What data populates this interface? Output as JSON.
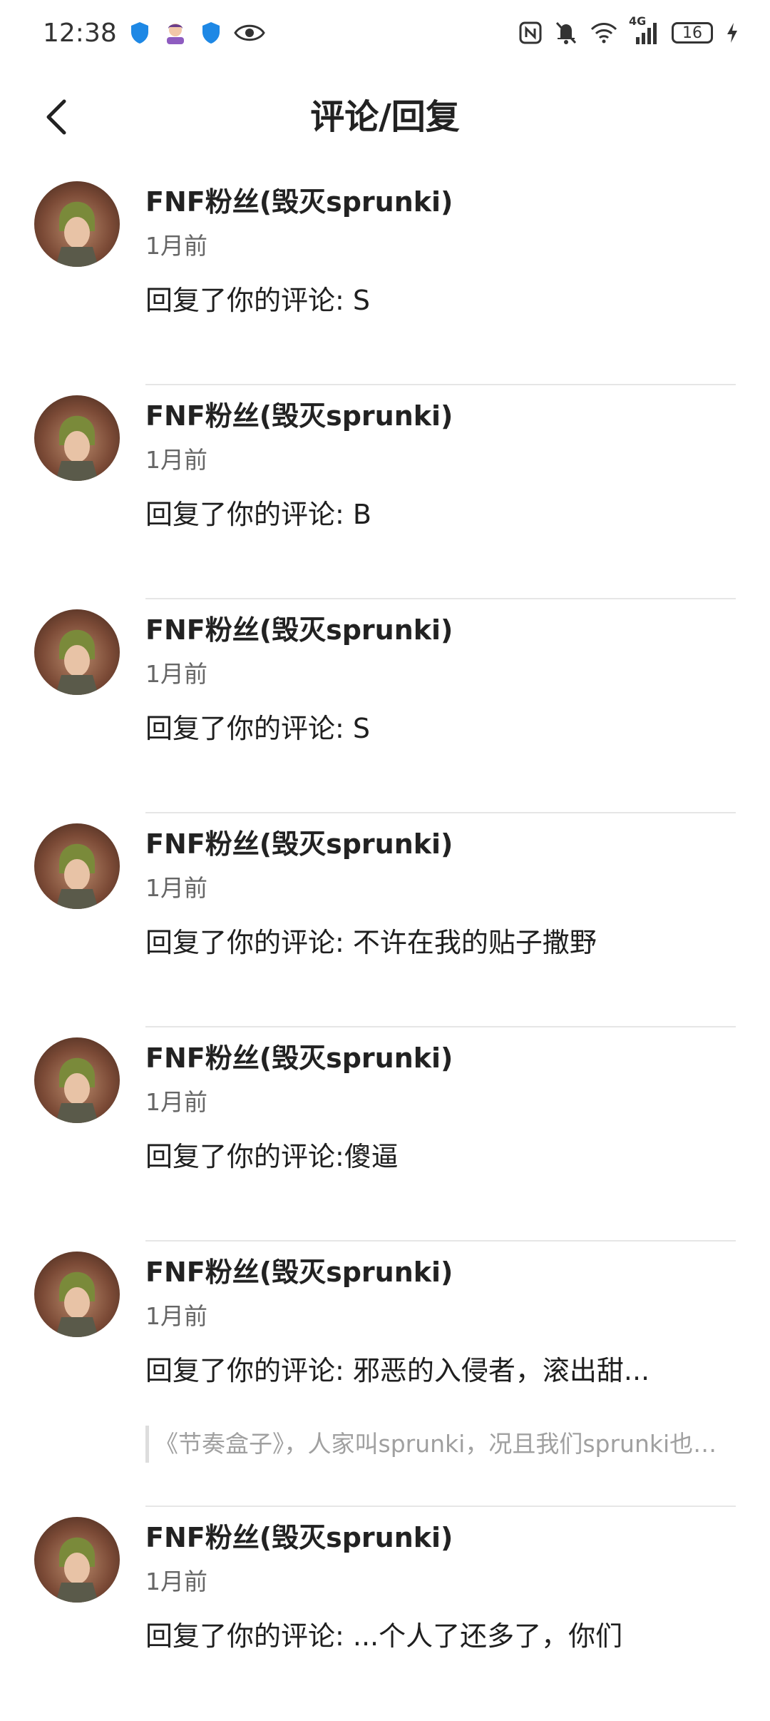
{
  "status_bar": {
    "time": "12:38",
    "network": "4G",
    "battery": "16"
  },
  "header": {
    "title": "评论/回复"
  },
  "notifications": [
    {
      "username": "FNF粉丝(毁灭sprunki)",
      "time": "1月前",
      "reply": "回复了你的评论: S"
    },
    {
      "username": "FNF粉丝(毁灭sprunki)",
      "time": "1月前",
      "reply": "回复了你的评论: B"
    },
    {
      "username": "FNF粉丝(毁灭sprunki)",
      "time": "1月前",
      "reply": "回复了你的评论: S"
    },
    {
      "username": "FNF粉丝(毁灭sprunki)",
      "time": "1月前",
      "reply": "回复了你的评论: 不许在我的贴子撒野"
    },
    {
      "username": "FNF粉丝(毁灭sprunki)",
      "time": "1月前",
      "reply": "回复了你的评论:傻逼"
    },
    {
      "username": "FNF粉丝(毁灭sprunki)",
      "time": "1月前",
      "reply": "回复了你的评论: 邪恶的入侵者，滚出甜...",
      "quote": "《节奏盒子》，人家叫sprunki，况且我们sprunki也…"
    },
    {
      "username": "FNF粉丝(毁灭sprunki)",
      "time": "1月前",
      "reply": "回复了你的评论: ...个人了还多了，你们"
    }
  ],
  "colors": {
    "divider": "#e6e6e6",
    "quote_text": "#a0a0a0",
    "shield": "#1e88e5"
  }
}
